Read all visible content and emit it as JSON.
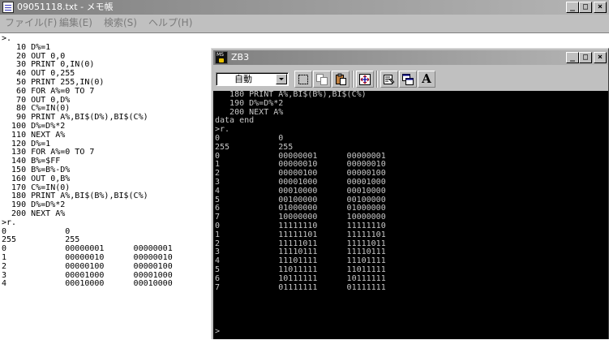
{
  "notepad": {
    "title": "09051118.txt - メモ帳",
    "menu": [
      "ファイル(F)",
      "編集(E)",
      "検索(S)",
      "ヘルプ(H)"
    ],
    "caption_buttons": {
      "minimize": "_",
      "maximize": "□",
      "close": "×"
    },
    "text": ">.\n   10 D%=1\n   20 OUT 0,0\n   30 PRINT 0,IN(0)\n   40 OUT 0,255\n   50 PRINT 255,IN(0)\n   60 FOR A%=0 TO 7\n   70 OUT 0,D%\n   80 C%=IN(0)\n   90 PRINT A%,BI$(D%),BI$(C%)\n  100 D%=D%*2\n  110 NEXT A%\n  120 D%=1\n  130 FOR A%=0 TO 7\n  140 B%=$FF\n  150 B%=B%-D%\n  160 OUT 0,B%\n  170 C%=IN(0)\n  180 PRINT A%,BI$(B%),BI$(C%)\n  190 D%=D%*2\n  200 NEXT A%\n>r.\n0            0\n255          255\n0            00000001      00000001\n1            00000010      00000010\n2            00000100      00000100\n3            00001000      00001000\n4            00010000      00010000"
  },
  "zb3": {
    "title": "ZB3",
    "mode_select": "自動",
    "caption_buttons": {
      "minimize": "_",
      "maximize": "□",
      "close": "×"
    },
    "font_button_label": "A",
    "console_text": "   180 PRINT A%,BI$(B%),BI$(C%)\n   190 D%=D%*2\n   200 NEXT A%\ndata end\n>r.\n0            0\n255          255\n0            00000001      00000001\n1            00000010      00000010\n2            00000100      00000100\n3            00001000      00001000\n4            00010000      00010000\n5            00100000      00100000\n6            01000000      01000000\n7            10000000      10000000\n0            11111110      11111110\n1            11111101      11111101\n2            11111011      11111011\n3            11110111      11110111\n4            11101111      11101111\n5            11011111      11011111\n6            10111111      10111111\n7            01111111      01111111",
    "prompt": ">"
  }
}
